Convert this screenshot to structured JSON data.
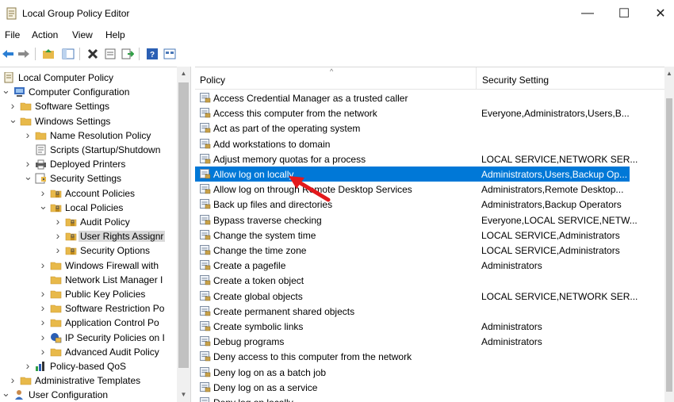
{
  "window": {
    "title": "Local Group Policy Editor",
    "minimize": "—",
    "maximize": "☐",
    "close": "✕"
  },
  "menu": [
    "File",
    "Action",
    "View",
    "Help"
  ],
  "toolbar_icons": [
    "back-arrow-icon",
    "forward-arrow-icon",
    "up-folder-icon",
    "show-hide-tree-icon",
    "delete-icon",
    "properties-icon",
    "export-list-icon",
    "help-icon",
    "console-view-icon"
  ],
  "tree": {
    "items": [
      {
        "label": "Local Computer Policy",
        "level": 0,
        "expand": "",
        "icon": "policy-icon"
      },
      {
        "label": "Computer Configuration",
        "level": 0,
        "expand": "v",
        "icon": "computer-icon"
      },
      {
        "label": "Software Settings",
        "level": 1,
        "expand": ">",
        "icon": "folder-icon"
      },
      {
        "label": "Windows Settings",
        "level": 1,
        "expand": "v",
        "icon": "folder-icon"
      },
      {
        "label": "Name Resolution Policy",
        "level": 2,
        "expand": ">",
        "icon": "folder-icon"
      },
      {
        "label": "Scripts (Startup/Shutdown",
        "level": 2,
        "expand": "",
        "icon": "script-icon"
      },
      {
        "label": "Deployed Printers",
        "level": 2,
        "expand": ">",
        "icon": "printer-icon"
      },
      {
        "label": "Security Settings",
        "level": 2,
        "expand": "v",
        "icon": "security-icon"
      },
      {
        "label": "Account Policies",
        "level": 3,
        "expand": ">",
        "icon": "security-folder-icon"
      },
      {
        "label": "Local Policies",
        "level": 3,
        "expand": "v",
        "icon": "security-folder-icon"
      },
      {
        "label": "Audit Policy",
        "level": 4,
        "expand": ">",
        "icon": "security-folder-icon"
      },
      {
        "label": "User Rights Assignr",
        "level": 4,
        "expand": ">",
        "icon": "security-folder-icon",
        "selected": true
      },
      {
        "label": "Security Options",
        "level": 4,
        "expand": ">",
        "icon": "security-folder-icon"
      },
      {
        "label": "Windows Firewall with",
        "level": 3,
        "expand": ">",
        "icon": "folder-icon"
      },
      {
        "label": "Network List Manager I",
        "level": 3,
        "expand": "",
        "icon": "folder-icon"
      },
      {
        "label": "Public Key Policies",
        "level": 3,
        "expand": ">",
        "icon": "folder-icon"
      },
      {
        "label": "Software Restriction Po",
        "level": 3,
        "expand": ">",
        "icon": "folder-icon"
      },
      {
        "label": "Application Control Po",
        "level": 3,
        "expand": ">",
        "icon": "folder-icon"
      },
      {
        "label": "IP Security Policies on I",
        "level": 3,
        "expand": ">",
        "icon": "ipsec-icon"
      },
      {
        "label": "Advanced Audit Policy",
        "level": 3,
        "expand": ">",
        "icon": "folder-icon"
      },
      {
        "label": "Policy-based QoS",
        "level": 2,
        "expand": ">",
        "icon": "qos-chart-icon"
      },
      {
        "label": "Administrative Templates",
        "level": 1,
        "expand": ">",
        "icon": "folder-icon"
      },
      {
        "label": "User Configuration",
        "level": 0,
        "expand": "v",
        "icon": "user-icon"
      }
    ]
  },
  "list": {
    "col_policy": "Policy",
    "col_setting": "Security Setting",
    "rows": [
      {
        "policy": "Access Credential Manager as a trusted caller",
        "setting": ""
      },
      {
        "policy": "Access this computer from the network",
        "setting": "Everyone,Administrators,Users,B..."
      },
      {
        "policy": "Act as part of the operating system",
        "setting": ""
      },
      {
        "policy": "Add workstations to domain",
        "setting": ""
      },
      {
        "policy": "Adjust memory quotas for a process",
        "setting": "LOCAL SERVICE,NETWORK SER..."
      },
      {
        "policy": "Allow log on locally",
        "setting": "Administrators,Users,Backup Op...",
        "selected": true
      },
      {
        "policy": "Allow log on through Remote Desktop Services",
        "setting": "Administrators,Remote Desktop..."
      },
      {
        "policy": "Back up files and directories",
        "setting": "Administrators,Backup Operators"
      },
      {
        "policy": "Bypass traverse checking",
        "setting": "Everyone,LOCAL SERVICE,NETW..."
      },
      {
        "policy": "Change the system time",
        "setting": "LOCAL SERVICE,Administrators"
      },
      {
        "policy": "Change the time zone",
        "setting": "LOCAL SERVICE,Administrators"
      },
      {
        "policy": "Create a pagefile",
        "setting": "Administrators"
      },
      {
        "policy": "Create a token object",
        "setting": ""
      },
      {
        "policy": "Create global objects",
        "setting": "LOCAL SERVICE,NETWORK SER..."
      },
      {
        "policy": "Create permanent shared objects",
        "setting": ""
      },
      {
        "policy": "Create symbolic links",
        "setting": "Administrators"
      },
      {
        "policy": "Debug programs",
        "setting": "Administrators"
      },
      {
        "policy": "Deny access to this computer from the network",
        "setting": ""
      },
      {
        "policy": "Deny log on as a batch job",
        "setting": ""
      },
      {
        "policy": "Deny log on as a service",
        "setting": ""
      },
      {
        "policy": "Deny log on locally",
        "setting": ""
      }
    ]
  },
  "colors": {
    "selection": "#0078d7",
    "tree_selection": "#d9d9d9",
    "annotation_arrow": "#e3191c",
    "folder": "#e8b94a"
  }
}
